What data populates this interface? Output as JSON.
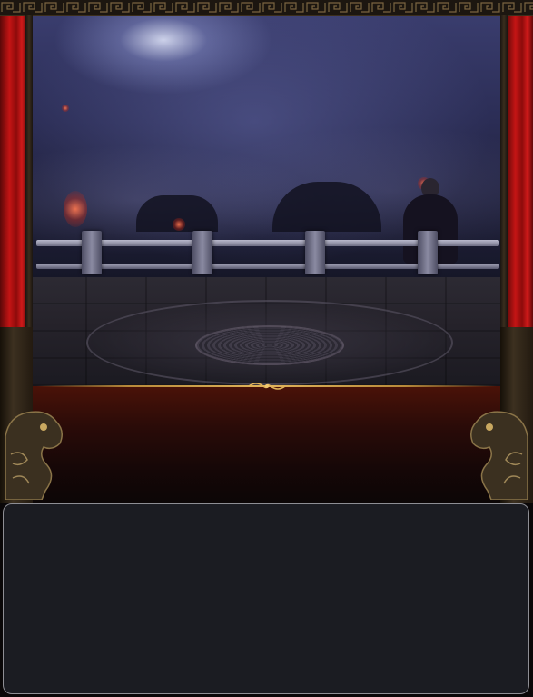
{
  "scene": {
    "name": "temple-stage",
    "time_of_day": "night",
    "colors": {
      "sky": "#2b2d55",
      "moon_glow": "#e6ebff",
      "curtain_red": "#c41414",
      "stage_red": "#4a1208",
      "gold_trim": "#e0b45a",
      "floor": "#26232b"
    },
    "icons": [
      "moon-glow",
      "stone-railing",
      "floor-medallion",
      "red-curtain-left",
      "red-curtain-right",
      "dragon-statue-left",
      "dragon-statue-right",
      "gold-ornament",
      "silhouette-figure"
    ]
  },
  "panel": {
    "color": "#1b1c22",
    "border_color": "#8e8e94"
  }
}
